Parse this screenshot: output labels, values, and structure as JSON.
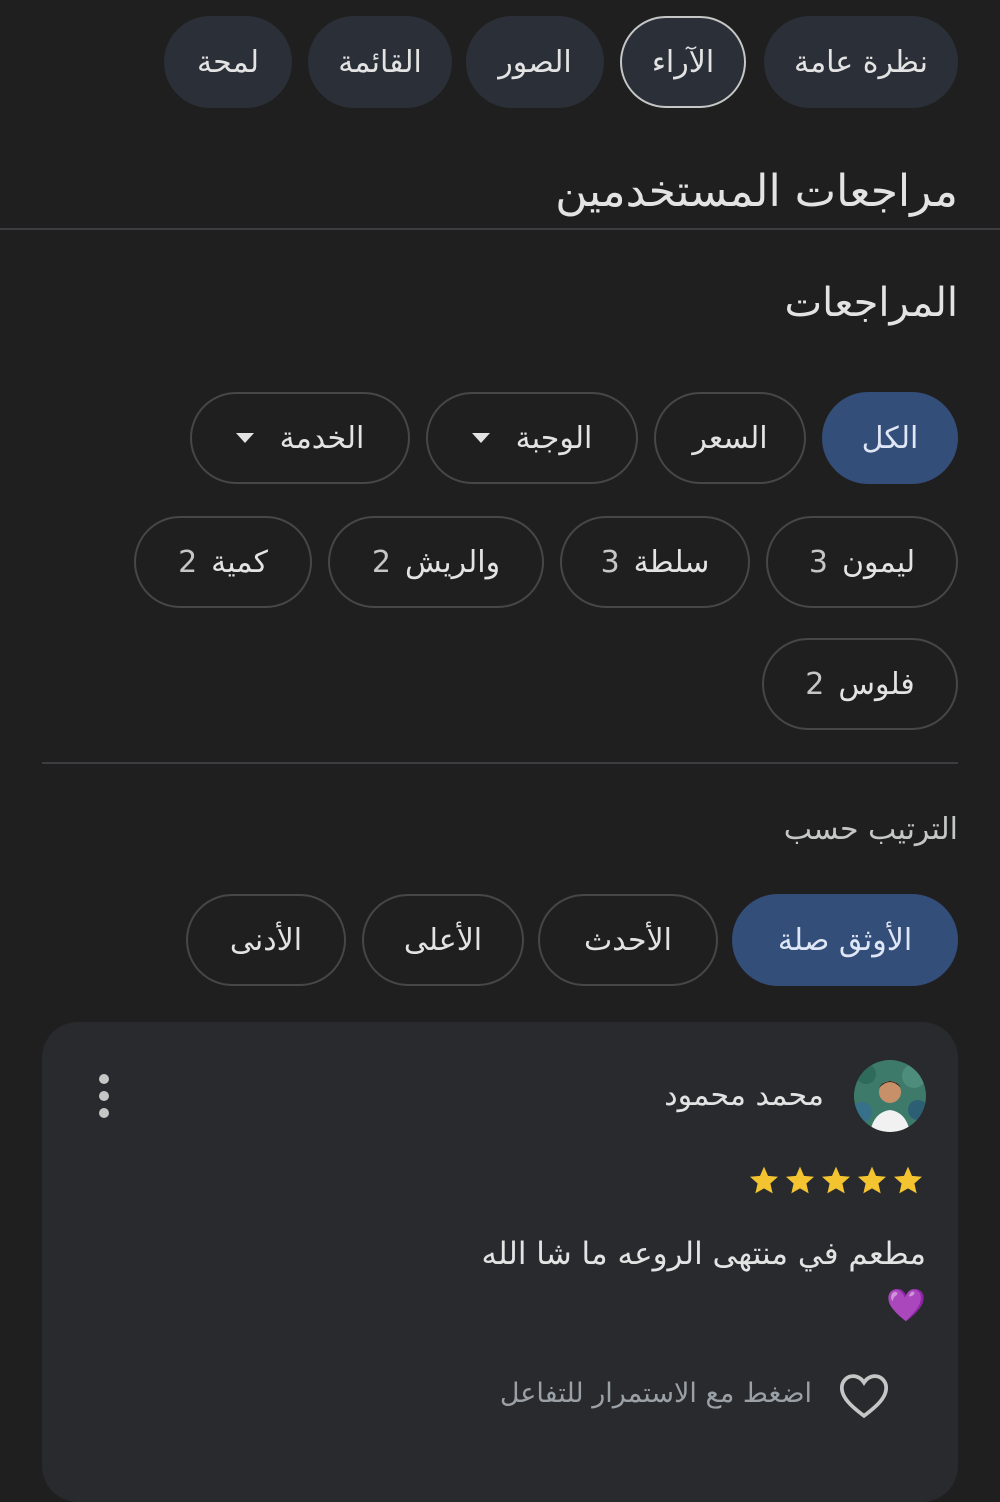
{
  "tabs": [
    {
      "label": "نظرة عامة"
    },
    {
      "label": "الآراء"
    },
    {
      "label": "الصور"
    },
    {
      "label": "القائمة"
    },
    {
      "label": "لمحة"
    }
  ],
  "section_title": "مراجعات المستخدمين",
  "reviews_heading": "المراجعات",
  "filter_chips": [
    {
      "label": "الكل"
    },
    {
      "label": "السعر"
    },
    {
      "label": "الوجبة"
    },
    {
      "label": "الخدمة"
    }
  ],
  "topic_chips": [
    {
      "label": "ليمون",
      "count": "3"
    },
    {
      "label": "سلطة",
      "count": "3"
    },
    {
      "label": "والريش",
      "count": "2"
    },
    {
      "label": "كمية",
      "count": "2"
    },
    {
      "label": "فلوس",
      "count": "2"
    }
  ],
  "sort": {
    "label": "الترتيب حسب",
    "options": [
      {
        "label": "الأوثق صلة"
      },
      {
        "label": "الأحدث"
      },
      {
        "label": "الأعلى"
      },
      {
        "label": "الأدنى"
      }
    ]
  },
  "review": {
    "author": "محمد محمود",
    "rating": 5,
    "text": "مطعم في منتهى الروعه ما شا الله",
    "emoji": "💜",
    "like_hint": "اضغط مع الاستمرار للتفاعل"
  },
  "colors": {
    "background": "#1f1f1f",
    "card": "#282a2d",
    "selected_chip": "#344e7a",
    "star": "#f4c430"
  },
  "icons": [
    "caret-down-icon",
    "star-icon",
    "more-vert-icon",
    "heart-outline-icon"
  ]
}
